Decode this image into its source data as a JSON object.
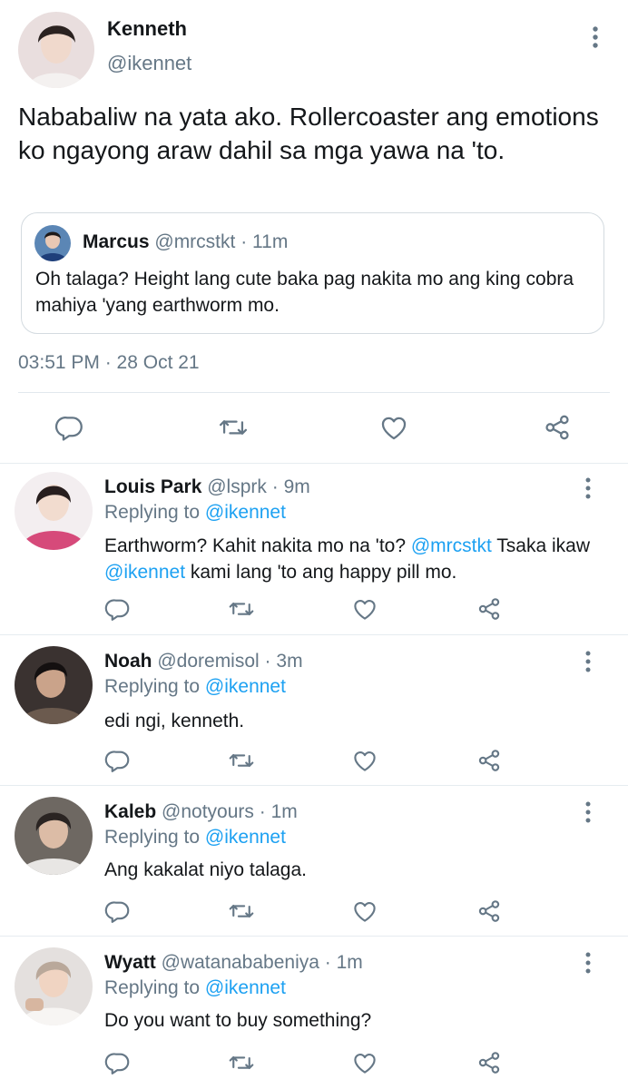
{
  "main_tweet": {
    "author_name": "Kenneth",
    "author_handle": "@ikennet",
    "text": "Nababaliw na yata ako. Rollercoaster ang emotions ko ngayong araw dahil sa mga yawa na 'to.",
    "quoted": {
      "name": "Marcus",
      "handle": "@mrcstkt",
      "separator": "·",
      "time": "11m",
      "text": "Oh talaga? Height lang cute baka pag nakita mo ang king cobra mahiya 'yang earthworm mo."
    },
    "timestamp": "03:51 PM · 28 Oct 21",
    "actions": [
      "reply-icon",
      "retweet-icon",
      "like-icon",
      "share-icon"
    ]
  },
  "replies": [
    {
      "name": "Louis Park",
      "handle": "@lsprk",
      "separator": "·",
      "time": "9m",
      "replying_prefix": "Replying to",
      "replying_to": "@ikennet",
      "text_parts": [
        "Earthworm? Kahit nakita mo na 'to? ",
        "@mrcstkt",
        " Tsaka ikaw ",
        "@ikennet",
        " kami lang 'to ang happy pill mo."
      ]
    },
    {
      "name": "Noah",
      "handle": "@doremisol",
      "separator": "·",
      "time": "3m",
      "replying_prefix": "Replying to",
      "replying_to": "@ikennet",
      "text": "edi ngi, kenneth."
    },
    {
      "name": "Kaleb",
      "handle": "@notyours",
      "separator": "·",
      "time": "1m",
      "replying_prefix": "Replying to",
      "replying_to": "@ikennet",
      "text": "Ang kakalat niyo talaga."
    },
    {
      "name": "Wyatt",
      "handle": "@watanababeniya",
      "separator": "·",
      "time": "1m",
      "replying_prefix": "Replying to",
      "replying_to": "@ikennet",
      "text": "Do you want to buy something?"
    }
  ],
  "colors": {
    "accent": "#1da1f2",
    "secondary_text": "#657786",
    "primary_text": "#14171a",
    "divider": "#e1e8ed"
  }
}
